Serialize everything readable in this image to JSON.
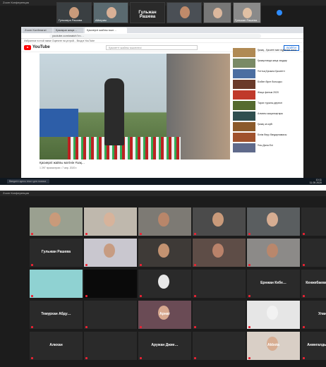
{
  "top_strip": [
    {
      "caption": "Гульмира Рашова",
      "label": ""
    },
    {
      "caption": "Айгерим",
      "label": ""
    },
    {
      "caption": "",
      "label": "Гульжан Рашева"
    },
    {
      "caption": "",
      "label": ""
    },
    {
      "caption": "",
      "label": ""
    },
    {
      "caption": "Гульжан Рашева",
      "label": ""
    }
  ],
  "browser": {
    "tabs": [
      "Zoom Konferanzi",
      "Қазақша жаңа…",
      "Қасиерлі жайлы мәл…"
    ],
    "url": "youtube.com/watch?v=…",
    "bookmarks": "Избранное в этой папке  Оцените на устрой...  Вход в YouTube",
    "yt_name": "YouTube",
    "search_placeholder": "Қасиетті жайлы мәселесі",
    "signin": "ВОЙТИ",
    "video_title": "Қасиерлі жайлы мәтінін Ұзақ…",
    "video_meta": "1 297 просмотров • 7 апр. 2020 г."
  },
  "recs": [
    {
      "text": "Қазақ - Қасиеті ман мұратын алса",
      "color": "#b08a54"
    },
    {
      "text": "Қазақстанда жаңа заңдар",
      "color": "#7a8a66"
    },
    {
      "text": "Ұлттық Қазына Қасиетті",
      "color": "#4b6ea1"
    },
    {
      "text": "Бізбен бірге болыңыз",
      "color": "#6a3a2a"
    },
    {
      "text": "Жаңа фильм 2020",
      "color": "#c0392b"
    },
    {
      "text": "Тарих туралы деректі",
      "color": "#556b2f"
    },
    {
      "text": "Алматы жаңалықтары",
      "color": "#2f4f4f"
    },
    {
      "text": "Қазақ ән-күйі",
      "color": "#8b5a2b"
    },
    {
      "text": "Білім беру бағдарламасы",
      "color": "#a0522d"
    },
    {
      "text": "Ұлы Дала Елі",
      "color": "#5f6a8b"
    }
  ],
  "taskbar": {
    "search": "Введите здесь текст для поиска",
    "time": "10:11",
    "date": "11.05.2020"
  },
  "window_title": "Zoom Конференция",
  "grid": [
    [
      "",
      "",
      "",
      "",
      "",
      ""
    ],
    [
      "Гульжан Рашева",
      "",
      "",
      "",
      "",
      ""
    ],
    [
      "",
      "",
      "",
      "",
      "Ернжан Кебе…",
      "Кенжебаева Гули…"
    ],
    [
      "Темурхан Абду…",
      "",
      "Арнат",
      "",
      "",
      "Улан"
    ],
    [
      "Алихан",
      "",
      "Аружан Джие…",
      "",
      "Akbota",
      "Анингалды Наз…"
    ]
  ]
}
